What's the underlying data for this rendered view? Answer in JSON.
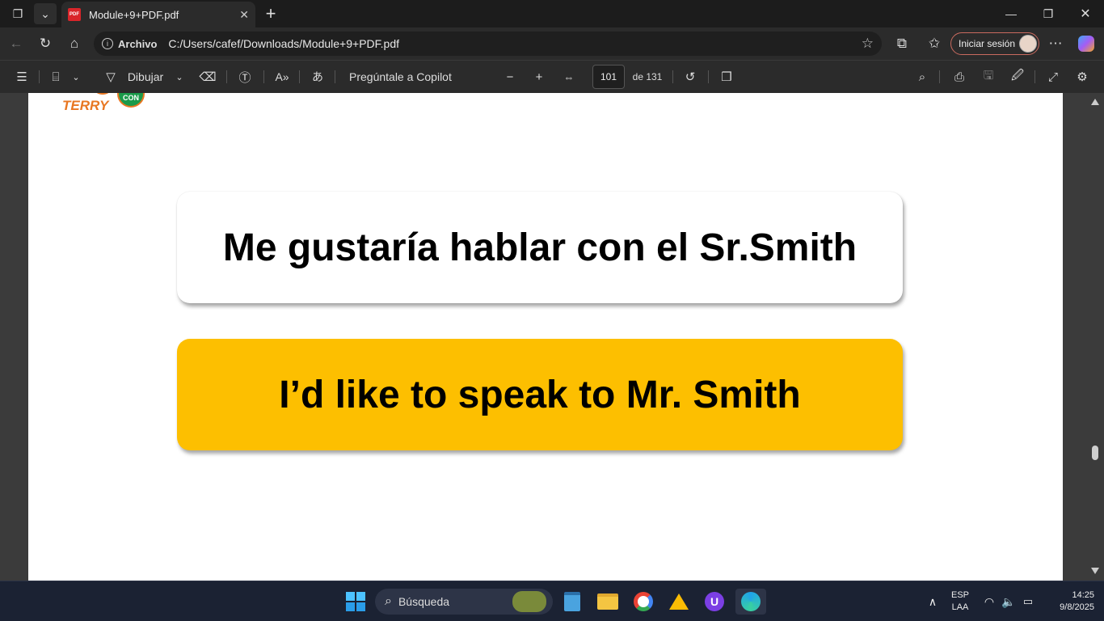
{
  "browser": {
    "tab_title": "Module+9+PDF.pdf",
    "address_label": "Archivo",
    "url": "C:/Users/cafef/Downloads/Module+9+PDF.pdf",
    "signin_label": "Iniciar sesión"
  },
  "pdf_toolbar": {
    "draw_label": "Dibujar",
    "copilot_label": "Pregúntale a Copilot",
    "current_page": "101",
    "page_total": "de 131"
  },
  "document": {
    "logo_text": "TERRY",
    "logo_badge": "CON",
    "phrase_spanish": "Me gustaría hablar con el Sr.Smith",
    "phrase_english": "I’d like to speak to Mr. Smith",
    "colors": {
      "highlight_card": "#fdbf00",
      "logo_orange": "#e87722",
      "logo_green": "#1a9a4a"
    }
  },
  "taskbar": {
    "search_placeholder": "Búsqueda",
    "language_top": "ESP",
    "language_bottom": "LAA",
    "time": "14:25",
    "date": "9/8/2025"
  }
}
